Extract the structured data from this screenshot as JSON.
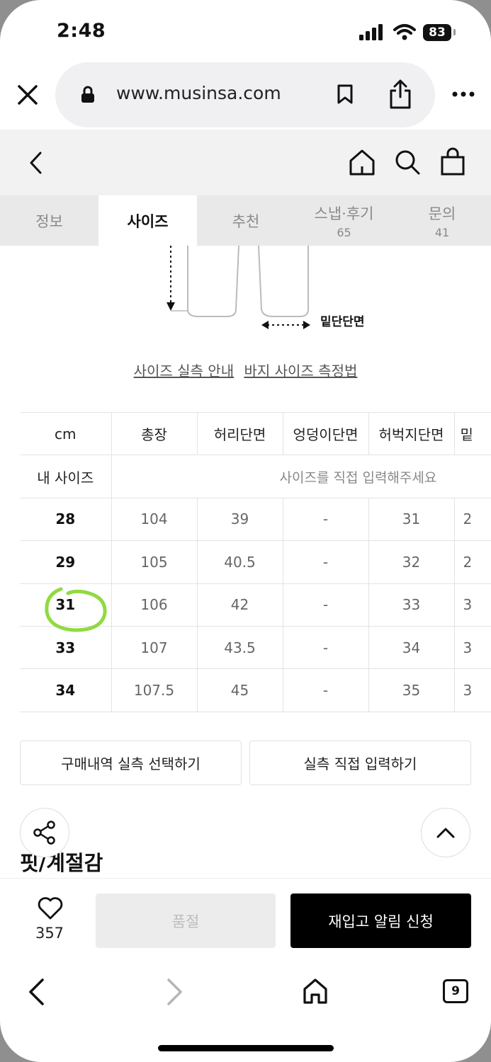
{
  "status_bar": {
    "time": "2:48",
    "battery": "83"
  },
  "browser": {
    "url": "www.musinsa.com",
    "tabs_count": "9"
  },
  "tabs": [
    {
      "label": "정보",
      "count": ""
    },
    {
      "label": "사이즈",
      "count": ""
    },
    {
      "label": "추천",
      "count": ""
    },
    {
      "label": "스냅·후기",
      "count": "65"
    },
    {
      "label": "문의",
      "count": "41"
    }
  ],
  "diagram": {
    "label": "밑단단면"
  },
  "links": {
    "guide": "사이즈 실측 안내",
    "measure": "바지 사이즈 측정법"
  },
  "size_table": {
    "headers": [
      "cm",
      "총장",
      "허리단면",
      "엉덩이단면",
      "허벅지단면",
      "밑"
    ],
    "my_size": {
      "label": "내 사이즈",
      "hint": "사이즈를 직접 입력해주세요"
    },
    "rows": [
      {
        "size": "28",
        "values": [
          "104",
          "39",
          "-",
          "31",
          "2"
        ]
      },
      {
        "size": "29",
        "values": [
          "105",
          "40.5",
          "-",
          "32",
          "2"
        ]
      },
      {
        "size": "31",
        "values": [
          "106",
          "42",
          "-",
          "33",
          "3"
        ]
      },
      {
        "size": "33",
        "values": [
          "107",
          "43.5",
          "-",
          "34",
          "3"
        ]
      },
      {
        "size": "34",
        "values": [
          "107.5",
          "45",
          "-",
          "35",
          "3"
        ]
      }
    ]
  },
  "buttons": {
    "purchase_history": "구매내역 실측 선택하기",
    "direct_input": "실측 직접 입력하기"
  },
  "section": {
    "title": "핏/계절감"
  },
  "purchase_bar": {
    "like_count": "357",
    "soldout_label": "품절",
    "restock_label": "재입고 알림 신청"
  },
  "colors": {
    "highlight_circle": "#7ed321",
    "primary_button": "#000000"
  }
}
